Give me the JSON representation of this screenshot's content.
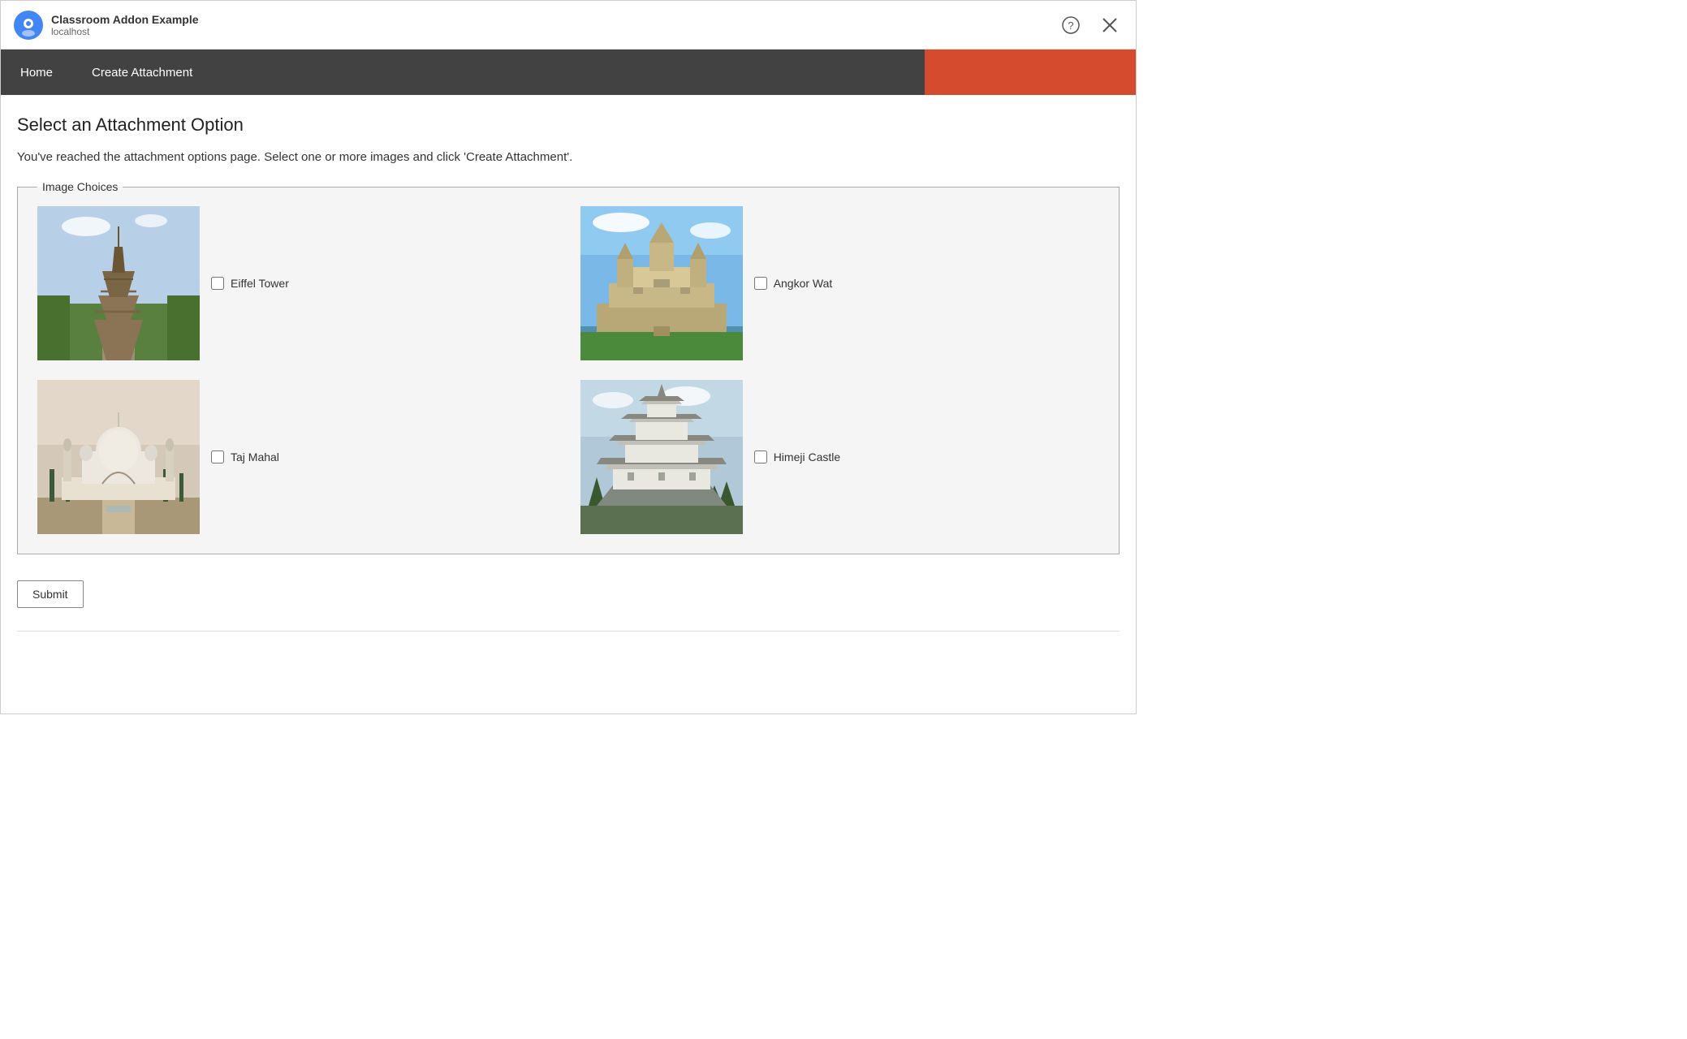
{
  "titleBar": {
    "appTitle": "Classroom Addon Example",
    "appSubtitle": "localhost",
    "helpBtn": "?",
    "closeBtn": "✕"
  },
  "navBar": {
    "items": [
      {
        "id": "home",
        "label": "Home"
      },
      {
        "id": "create-attachment",
        "label": "Create Attachment"
      }
    ],
    "actionBtn": ""
  },
  "mainContent": {
    "pageTitle": "Select an Attachment Option",
    "description": "You've reached the attachment options page. Select one or more images and click 'Create Attachment'.",
    "fieldsetLegend": "Image Choices",
    "images": [
      {
        "id": "eiffel-tower",
        "label": "Eiffel Tower",
        "type": "eiffel"
      },
      {
        "id": "angkor-wat",
        "label": "Angkor Wat",
        "type": "angkor"
      },
      {
        "id": "taj-mahal",
        "label": "Taj Mahal",
        "type": "tajmahal"
      },
      {
        "id": "himeji-castle",
        "label": "Himeji Castle",
        "type": "himeji"
      }
    ],
    "submitBtn": "Submit"
  }
}
